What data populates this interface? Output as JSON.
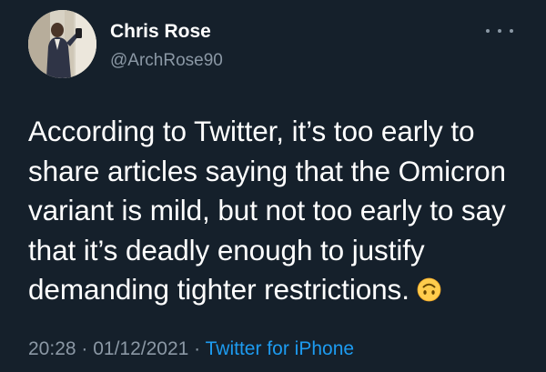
{
  "user": {
    "display_name": "Chris Rose",
    "handle": "@ArchRose90"
  },
  "tweet": {
    "text": "According to Twitter, it’s too early to share articles saying that the Omicron variant is mild, but not too early to say that it’s deadly enough to justify demanding tighter restrictions.",
    "emoji": "upside-down-face-emoji",
    "time": "20:28",
    "separator_1": " · ",
    "date": "01/12/2021",
    "separator_2": " · ",
    "source": "Twitter for iPhone"
  },
  "icons": {
    "more": "more-dots-icon"
  },
  "colors": {
    "background": "#15202b",
    "text": "#ffffff",
    "muted": "#8b98a5",
    "accent": "#1d9bf0"
  }
}
